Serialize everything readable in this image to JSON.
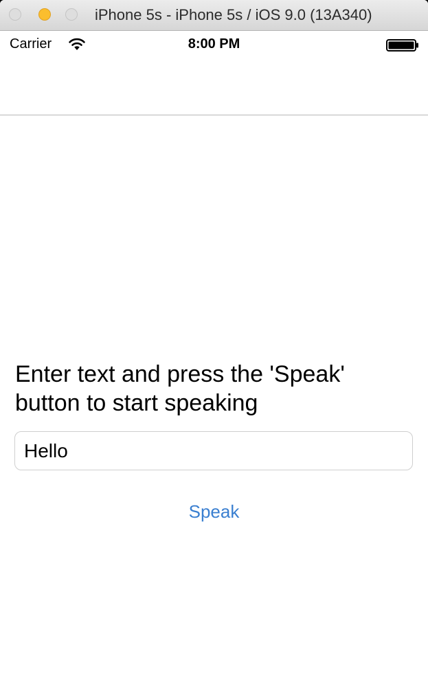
{
  "window": {
    "title": "iPhone 5s - iPhone 5s / iOS 9.0 (13A340)"
  },
  "status_bar": {
    "carrier": "Carrier",
    "time": "8:00 PM",
    "icons": [
      "wifi-icon",
      "battery-icon"
    ]
  },
  "main": {
    "instructions": "Enter text and press the 'Speak' button to start speaking",
    "text_field_value": "Hello",
    "speak_button_label": "Speak"
  },
  "colors": {
    "accent": "#3a7fd0",
    "minimize_light": "#fbbe2e"
  }
}
